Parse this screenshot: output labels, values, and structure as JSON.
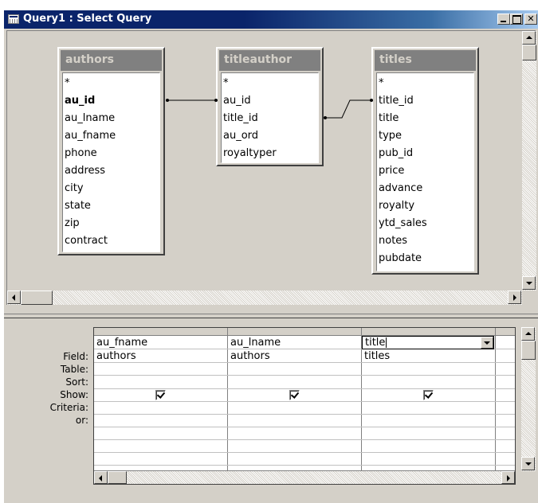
{
  "window": {
    "title": "Query1 : Select Query",
    "icon": "query-icon"
  },
  "tables": [
    {
      "name": "authors",
      "fields": [
        "*",
        "au_id",
        "au_lname",
        "au_fname",
        "phone",
        "address",
        "city",
        "state",
        "zip",
        "contract"
      ],
      "key_fields": [
        "au_id"
      ]
    },
    {
      "name": "titleauthor",
      "fields": [
        "*",
        "au_id",
        "title_id",
        "au_ord",
        "royaltyper"
      ],
      "key_fields": []
    },
    {
      "name": "titles",
      "fields": [
        "*",
        "title_id",
        "title",
        "type",
        "pub_id",
        "price",
        "advance",
        "royalty",
        "ytd_sales",
        "notes",
        "pubdate"
      ],
      "key_fields": []
    }
  ],
  "joins": [
    {
      "from": "authors.au_id",
      "to": "titleauthor.au_id"
    },
    {
      "from": "titleauthor.title_id",
      "to": "titles.title_id"
    }
  ],
  "grid": {
    "row_labels": {
      "field": "Field:",
      "table": "Table:",
      "sort": "Sort:",
      "show": "Show:",
      "criteria": "Criteria:",
      "or": "or:"
    },
    "columns": [
      {
        "field": "au_fname",
        "table": "authors",
        "sort": "",
        "show": true
      },
      {
        "field": "au_lname",
        "table": "authors",
        "sort": "",
        "show": true
      },
      {
        "field": "title",
        "table": "titles",
        "sort": "",
        "show": true
      }
    ]
  }
}
